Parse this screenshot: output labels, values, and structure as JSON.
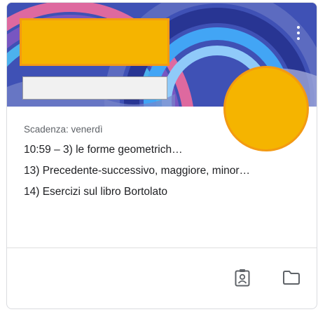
{
  "card": {
    "banner_color": "#3949ab",
    "title": "",
    "subtitle": "",
    "menu_icon": "more-vert-icon",
    "due": "Scadenza: venerdì",
    "items": [
      "10:59 – 3) le forme geometrich…",
      "13) Precedente-successivo, maggiore, minor…",
      "14) Esercizi sul libro Bortolato"
    ],
    "footer_icons": [
      "assignment-ind-icon",
      "folder-icon"
    ],
    "redaction_color": "#f5b400"
  }
}
